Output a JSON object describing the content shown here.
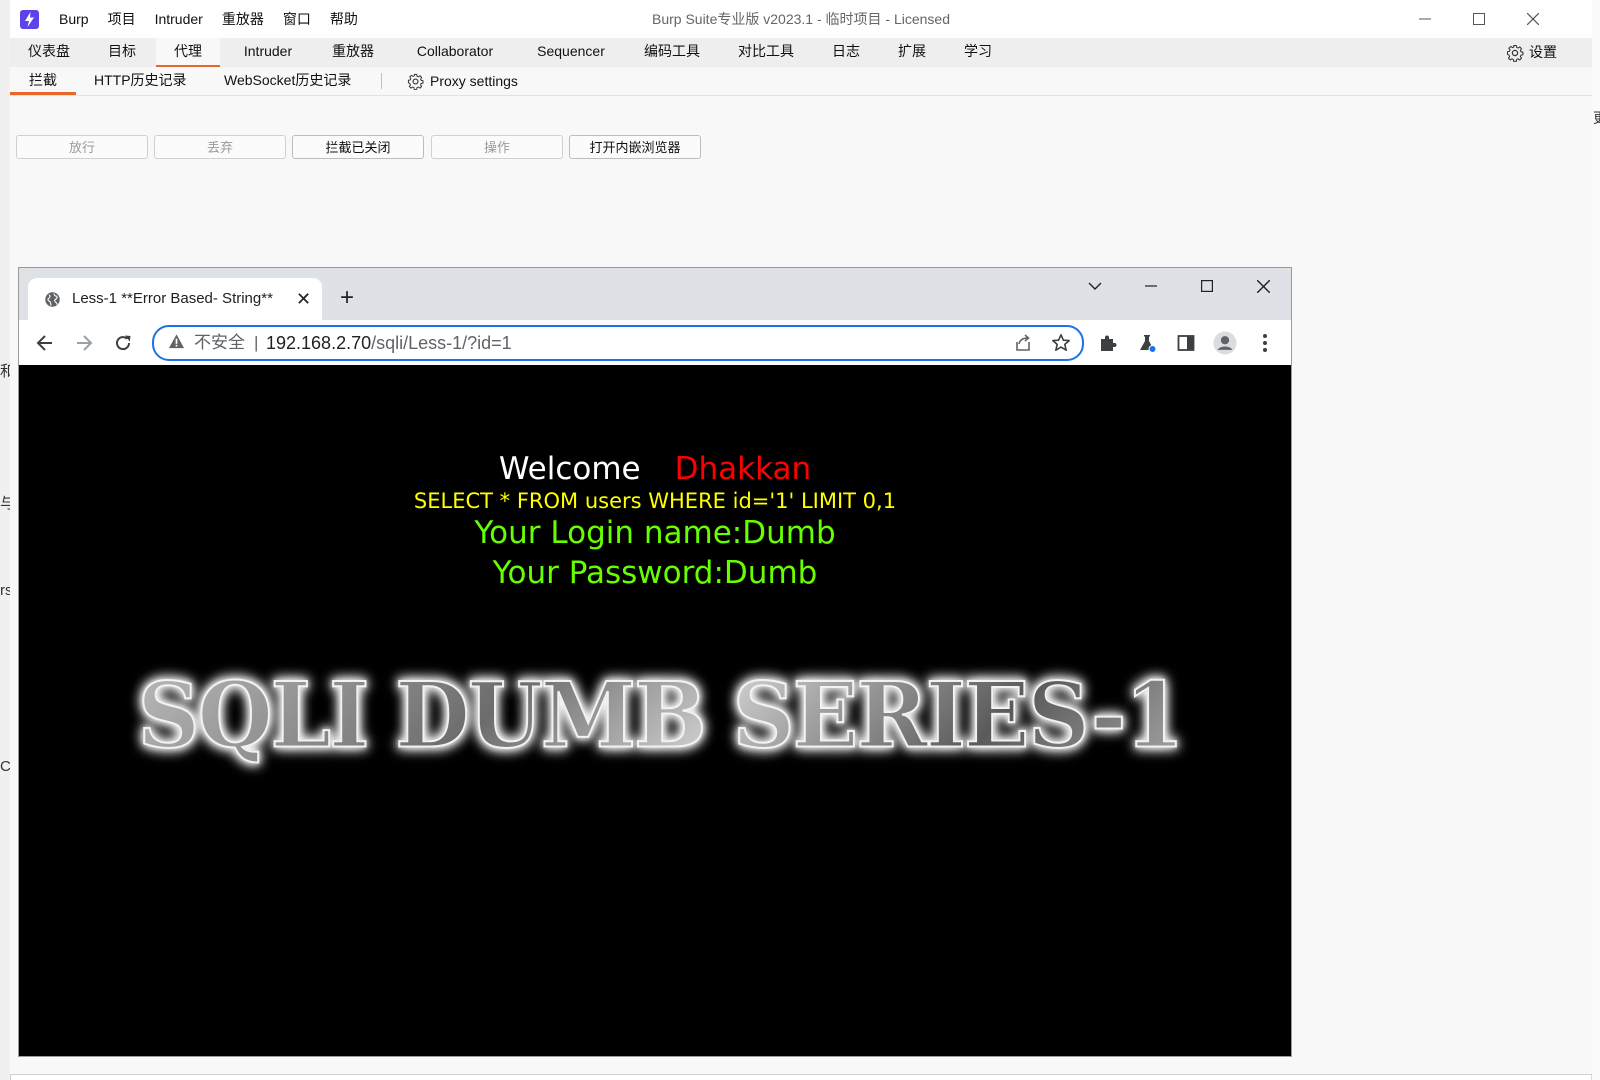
{
  "desktop": {
    "left_fragments": [
      "和",
      "与",
      "rs",
      "C"
    ],
    "right_fragments": [
      "更"
    ]
  },
  "burp": {
    "app_name": "Burp",
    "menu": [
      "Burp",
      "项目",
      "Intruder",
      "重放器",
      "窗口",
      "帮助"
    ],
    "window_title": "Burp Suite专业版  v2023.1 - 临时项目 - Licensed",
    "main_tabs": [
      "仪表盘",
      "目标",
      "代理",
      "Intruder",
      "重放器",
      "Collaborator",
      "Sequencer",
      "编码工具",
      "对比工具",
      "日志",
      "扩展",
      "学习"
    ],
    "active_main_tab": "代理",
    "settings_label": "设置",
    "sub_tabs": [
      "拦截",
      "HTTP历史记录",
      "WebSocket历史记录"
    ],
    "active_sub_tab": "拦截",
    "proxy_settings_label": "Proxy settings",
    "buttons": {
      "forward": "放行",
      "drop": "丢弃",
      "intercept": "拦截已关闭",
      "action": "操作",
      "open_browser": "打开内嵌浏览器"
    },
    "accent_color": "#e8672b"
  },
  "browser": {
    "tab_title": "Less-1 **Error Based- String**",
    "insecure_label": "不安全",
    "url_separator": "|",
    "url_host": "192.168.2.70",
    "url_path": "/sqli/Less-1/?id=1",
    "accent_color": "#1a73e8"
  },
  "page": {
    "welcome": "Welcome",
    "name": "Dhakkan",
    "query": "SELECT * FROM users WHERE id='1' LIMIT 0,1",
    "login": "Your Login name:Dumb",
    "password": "Your Password:Dumb",
    "banner": "SQLI DUMB SERIES-1"
  },
  "icons": {
    "app": "burp-logo-icon",
    "settings": "gear-icon",
    "globe": "globe-icon",
    "warning": "warning-icon",
    "share": "share-icon",
    "star": "star-icon",
    "extensions": "puzzle-icon",
    "labs": "flask-icon",
    "sidepanel": "side-panel-icon",
    "profile": "profile-icon",
    "menu": "kebab-menu-icon"
  }
}
